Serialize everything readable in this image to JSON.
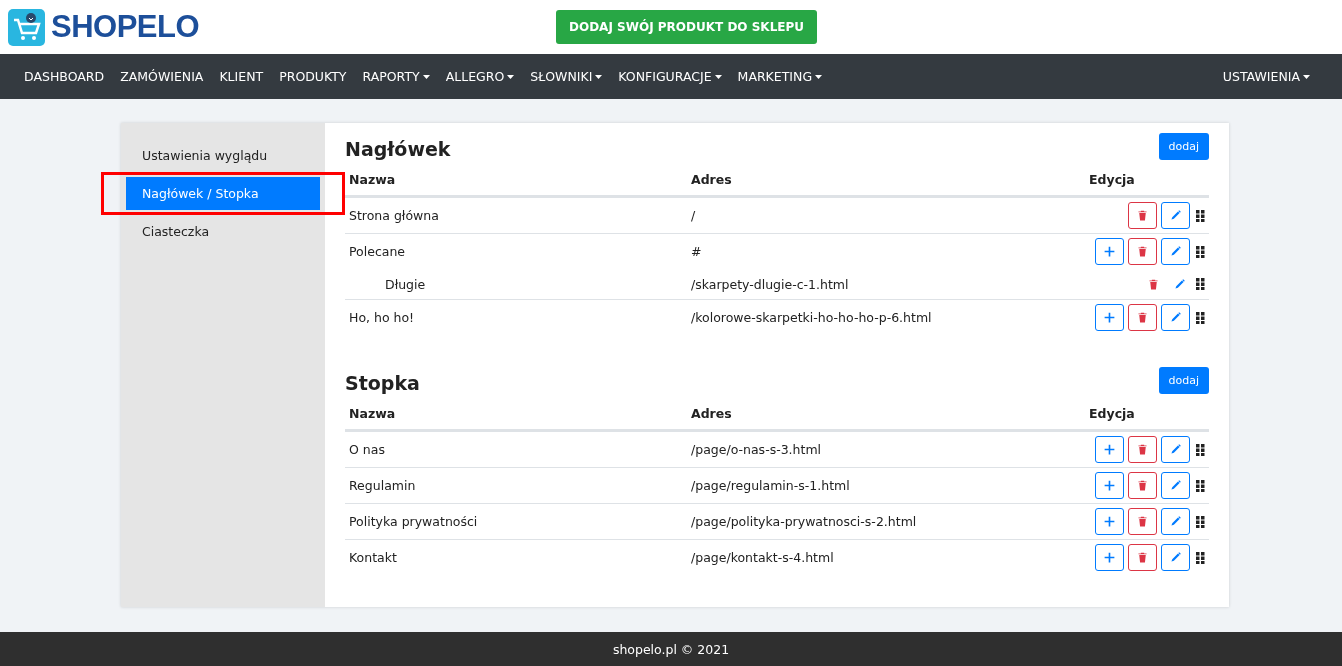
{
  "header": {
    "logo": "SHOPELO",
    "cta": "DODAJ SWÓJ PRODUKT DO SKLEPU"
  },
  "nav": {
    "items": [
      {
        "label": "DASHBOARD",
        "dropdown": false
      },
      {
        "label": "ZAMÓWIENIA",
        "dropdown": false
      },
      {
        "label": "KLIENT",
        "dropdown": false
      },
      {
        "label": "PRODUKTY",
        "dropdown": false
      },
      {
        "label": "RAPORTY",
        "dropdown": true
      },
      {
        "label": "ALLEGRO",
        "dropdown": true
      },
      {
        "label": "SŁOWNIKI",
        "dropdown": true
      },
      {
        "label": "KONFIGURACJE",
        "dropdown": true
      },
      {
        "label": "MARKETING",
        "dropdown": true
      }
    ],
    "right": {
      "label": "USTAWIENIA",
      "dropdown": true
    }
  },
  "sidebar": {
    "items": [
      {
        "label": "Ustawienia wyglądu",
        "selected": false,
        "highlighted": false
      },
      {
        "label": "Nagłówek / Stopka",
        "selected": true,
        "highlighted": true
      },
      {
        "label": "Ciasteczka",
        "selected": false,
        "highlighted": false
      }
    ]
  },
  "sections": [
    {
      "title": "Nagłówek",
      "add_button": "dodaj",
      "columns": [
        "Nazwa",
        "Adres",
        "Edycja"
      ],
      "rows": [
        {
          "name": "Strona główna",
          "address": "/",
          "can_add": false
        },
        {
          "name": "Polecane",
          "address": "#",
          "can_add": true,
          "children": [
            {
              "name": "Długie",
              "address": "/skarpety-dlugie-c-1.html",
              "can_add": false
            }
          ]
        },
        {
          "name": "Ho, ho ho!",
          "address": "/kolorowe-skarpetki-ho-ho-ho-p-6.html",
          "can_add": true
        }
      ]
    },
    {
      "title": "Stopka",
      "add_button": "dodaj",
      "columns": [
        "Nazwa",
        "Adres",
        "Edycja"
      ],
      "rows": [
        {
          "name": "O nas",
          "address": "/page/o-nas-s-3.html",
          "can_add": true
        },
        {
          "name": "Regulamin",
          "address": "/page/regulamin-s-1.html",
          "can_add": true
        },
        {
          "name": "Polityka prywatności",
          "address": "/page/polityka-prywatnosci-s-2.html",
          "can_add": true
        },
        {
          "name": "Kontakt",
          "address": "/page/kontakt-s-4.html",
          "can_add": true
        }
      ]
    }
  ],
  "footer": "shopelo.pl © 2021"
}
